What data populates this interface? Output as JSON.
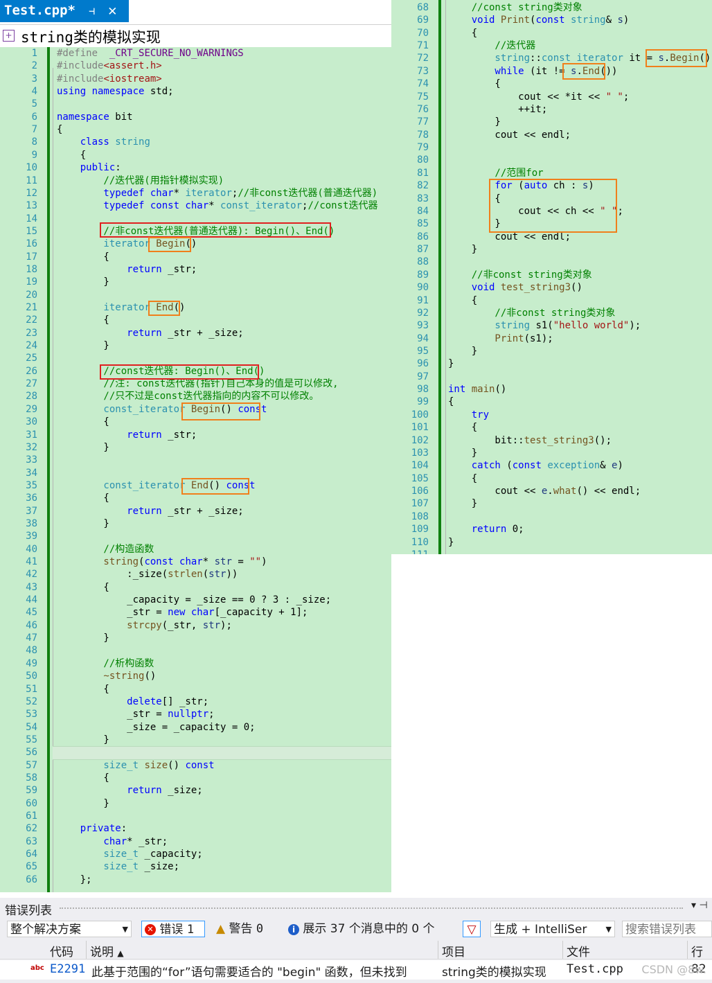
{
  "editor": {
    "tab_title": "Test.cpp*",
    "tab_pin_glyph": "⊣",
    "tab_close_glyph": "✕",
    "nav_project": "string类的模拟实现"
  },
  "left_lines": [
    {
      "n": "1",
      "t": [
        [
          "#define",
          "pp"
        ],
        [
          "  _CRT_SECURE_NO_WARNINGS",
          "mv"
        ]
      ]
    },
    {
      "n": "2",
      "t": [
        [
          "#include",
          "pp"
        ],
        [
          "<assert.h>",
          "st"
        ]
      ]
    },
    {
      "n": "3",
      "t": [
        [
          "#include",
          "pp"
        ],
        [
          "<iostream>",
          "st"
        ]
      ]
    },
    {
      "n": "4",
      "t": [
        [
          "using namespace ",
          "kw"
        ],
        [
          "std;",
          ""
        ]
      ]
    },
    {
      "n": "5",
      "t": []
    },
    {
      "n": "6",
      "t": [
        [
          "namespace ",
          "kw"
        ],
        [
          "bit",
          ""
        ]
      ]
    },
    {
      "n": "7",
      "t": [
        [
          "{",
          ""
        ]
      ]
    },
    {
      "n": "8",
      "t": [
        [
          "    class ",
          "kw"
        ],
        [
          "string",
          "ty"
        ]
      ]
    },
    {
      "n": "9",
      "t": [
        [
          "    {",
          ""
        ]
      ]
    },
    {
      "n": "10",
      "t": [
        [
          "    public",
          "kw"
        ],
        [
          ":",
          ""
        ]
      ]
    },
    {
      "n": "11",
      "t": [
        [
          "        //迭代器(用指针模拟实现)",
          "cm"
        ]
      ]
    },
    {
      "n": "12",
      "t": [
        [
          "        typedef ",
          "kw"
        ],
        [
          "char",
          "kw"
        ],
        [
          "* ",
          ""
        ],
        [
          "iterator",
          "ty"
        ],
        [
          ";",
          ""
        ],
        [
          "//非const迭代器(普通迭代器)",
          "cm"
        ]
      ]
    },
    {
      "n": "13",
      "t": [
        [
          "        typedef const char",
          "kw"
        ],
        [
          "* ",
          ""
        ],
        [
          "const_iterator",
          "ty"
        ],
        [
          ";",
          ""
        ],
        [
          "//const迭代器",
          "cm"
        ]
      ]
    },
    {
      "n": "14",
      "t": []
    },
    {
      "n": "15",
      "t": [
        [
          "        //非const迭代器(普通迭代器): Begin()、End()",
          "cm"
        ]
      ]
    },
    {
      "n": "16",
      "t": [
        [
          "        iterator ",
          "ty"
        ],
        [
          "Begin",
          "fn"
        ],
        [
          "()",
          ""
        ]
      ]
    },
    {
      "n": "17",
      "t": [
        [
          "        {",
          ""
        ]
      ]
    },
    {
      "n": "18",
      "t": [
        [
          "            return ",
          "kw"
        ],
        [
          "_str;",
          ""
        ]
      ]
    },
    {
      "n": "19",
      "t": [
        [
          "        }",
          ""
        ]
      ]
    },
    {
      "n": "20",
      "t": []
    },
    {
      "n": "21",
      "t": [
        [
          "        iterator ",
          "ty"
        ],
        [
          "End",
          "fn"
        ],
        [
          "()",
          ""
        ]
      ]
    },
    {
      "n": "22",
      "t": [
        [
          "        {",
          ""
        ]
      ]
    },
    {
      "n": "23",
      "t": [
        [
          "            return ",
          "kw"
        ],
        [
          "_str + _size;",
          ""
        ]
      ]
    },
    {
      "n": "24",
      "t": [
        [
          "        }",
          ""
        ]
      ]
    },
    {
      "n": "25",
      "t": []
    },
    {
      "n": "26",
      "t": [
        [
          "        //const迭代器: Begin()、End()",
          "cm"
        ]
      ]
    },
    {
      "n": "27",
      "t": [
        [
          "        //注: const迭代器(指针)自己本身的值是可以修改,",
          "cm"
        ]
      ]
    },
    {
      "n": "28",
      "t": [
        [
          "        //只不过是const迭代器指向的内容不可以修改。",
          "cm"
        ]
      ]
    },
    {
      "n": "29",
      "t": [
        [
          "        const_iterator ",
          "ty"
        ],
        [
          "Begin",
          "fn"
        ],
        [
          "() ",
          ""
        ],
        [
          "const",
          "kw"
        ]
      ]
    },
    {
      "n": "30",
      "t": [
        [
          "        {",
          ""
        ]
      ]
    },
    {
      "n": "31",
      "t": [
        [
          "            return ",
          "kw"
        ],
        [
          "_str;",
          ""
        ]
      ]
    },
    {
      "n": "32",
      "t": [
        [
          "        }",
          ""
        ]
      ]
    },
    {
      "n": "33",
      "t": []
    },
    {
      "n": "34",
      "t": []
    },
    {
      "n": "35",
      "t": [
        [
          "        const_iterator ",
          "ty"
        ],
        [
          "End",
          "fn"
        ],
        [
          "() ",
          ""
        ],
        [
          "const",
          "kw"
        ]
      ]
    },
    {
      "n": "36",
      "t": [
        [
          "        {",
          ""
        ]
      ]
    },
    {
      "n": "37",
      "t": [
        [
          "            return ",
          "kw"
        ],
        [
          "_str + _size;",
          ""
        ]
      ]
    },
    {
      "n": "38",
      "t": [
        [
          "        }",
          ""
        ]
      ]
    },
    {
      "n": "39",
      "t": []
    },
    {
      "n": "40",
      "t": [
        [
          "        //构造函数",
          "cm"
        ]
      ]
    },
    {
      "n": "41",
      "t": [
        [
          "        string",
          "fn"
        ],
        [
          "(",
          ""
        ],
        [
          "const char",
          "kw"
        ],
        [
          "* ",
          ""
        ],
        [
          "str",
          "pr"
        ],
        [
          " = ",
          ""
        ],
        [
          "\"\"",
          "st"
        ],
        [
          ")",
          ""
        ]
      ]
    },
    {
      "n": "42",
      "t": [
        [
          "            :_size(",
          ""
        ],
        [
          "strlen",
          "fn"
        ],
        [
          "(",
          ""
        ],
        [
          "str",
          "pr"
        ],
        [
          "))",
          ""
        ]
      ]
    },
    {
      "n": "43",
      "t": [
        [
          "        {",
          ""
        ]
      ]
    },
    {
      "n": "44",
      "t": [
        [
          "            _capacity = _size == 0 ? 3 : _size;",
          ""
        ]
      ]
    },
    {
      "n": "45",
      "t": [
        [
          "            _str = ",
          ""
        ],
        [
          "new char",
          "kw"
        ],
        [
          "[_capacity + 1];",
          ""
        ]
      ]
    },
    {
      "n": "46",
      "t": [
        [
          "            strcpy",
          "fn"
        ],
        [
          "(_str, ",
          ""
        ],
        [
          "str",
          "pr"
        ],
        [
          ");",
          ""
        ]
      ]
    },
    {
      "n": "47",
      "t": [
        [
          "        }",
          ""
        ]
      ]
    },
    {
      "n": "48",
      "t": []
    },
    {
      "n": "49",
      "t": [
        [
          "        //析构函数",
          "cm"
        ]
      ]
    },
    {
      "n": "50",
      "t": [
        [
          "        ~string",
          "fn"
        ],
        [
          "()",
          ""
        ]
      ]
    },
    {
      "n": "51",
      "t": [
        [
          "        {",
          ""
        ]
      ]
    },
    {
      "n": "52",
      "t": [
        [
          "            delete",
          "kw"
        ],
        [
          "[] _str;",
          ""
        ]
      ]
    },
    {
      "n": "53",
      "t": [
        [
          "            _str = ",
          ""
        ],
        [
          "nullptr",
          "kw"
        ],
        [
          ";",
          ""
        ]
      ]
    },
    {
      "n": "54",
      "t": [
        [
          "            _size = _capacity = 0;",
          ""
        ]
      ]
    },
    {
      "n": "55",
      "t": [
        [
          "        }",
          ""
        ]
      ]
    },
    {
      "n": "56",
      "t": []
    },
    {
      "n": "57",
      "t": [
        [
          "        size_t ",
          "ty"
        ],
        [
          "size",
          "fn"
        ],
        [
          "() ",
          ""
        ],
        [
          "const",
          "kw"
        ]
      ]
    },
    {
      "n": "58",
      "t": [
        [
          "        {",
          ""
        ]
      ]
    },
    {
      "n": "59",
      "t": [
        [
          "            return ",
          "kw"
        ],
        [
          "_size;",
          ""
        ]
      ]
    },
    {
      "n": "60",
      "t": [
        [
          "        }",
          ""
        ]
      ]
    },
    {
      "n": "61",
      "t": []
    },
    {
      "n": "62",
      "t": [
        [
          "    private",
          "kw"
        ],
        [
          ":",
          ""
        ]
      ]
    },
    {
      "n": "63",
      "t": [
        [
          "        char",
          "kw"
        ],
        [
          "* _str;",
          ""
        ]
      ]
    },
    {
      "n": "64",
      "t": [
        [
          "        size_t ",
          "ty"
        ],
        [
          "_capacity;",
          ""
        ]
      ]
    },
    {
      "n": "65",
      "t": [
        [
          "        size_t ",
          "ty"
        ],
        [
          "_size;",
          ""
        ]
      ]
    },
    {
      "n": "66",
      "t": [
        [
          "    };",
          ""
        ]
      ]
    }
  ],
  "right_lines": [
    {
      "n": "68",
      "t": [
        [
          "    //const string类对象",
          "cm"
        ]
      ]
    },
    {
      "n": "69",
      "t": [
        [
          "    void ",
          "kw"
        ],
        [
          "Print",
          "fn"
        ],
        [
          "(",
          ""
        ],
        [
          "const ",
          "kw"
        ],
        [
          "string",
          "ty"
        ],
        [
          "& ",
          ""
        ],
        [
          "s",
          "pr"
        ],
        [
          ")",
          ""
        ]
      ]
    },
    {
      "n": "70",
      "t": [
        [
          "    {",
          ""
        ]
      ]
    },
    {
      "n": "71",
      "t": [
        [
          "        //迭代器",
          "cm"
        ]
      ]
    },
    {
      "n": "72",
      "t": [
        [
          "        string",
          "ty"
        ],
        [
          "::",
          ""
        ],
        [
          "const_iterator ",
          "ty"
        ],
        [
          "it = ",
          ""
        ],
        [
          "s",
          "pr"
        ],
        [
          ".",
          ""
        ],
        [
          "Begin",
          "fn"
        ],
        [
          "();",
          ""
        ]
      ]
    },
    {
      "n": "73",
      "t": [
        [
          "        while ",
          "kw"
        ],
        [
          "(it != ",
          ""
        ],
        [
          "s",
          "pr"
        ],
        [
          ".",
          ""
        ],
        [
          "End",
          "fn"
        ],
        [
          "())",
          ""
        ]
      ]
    },
    {
      "n": "74",
      "t": [
        [
          "        {",
          ""
        ]
      ]
    },
    {
      "n": "75",
      "t": [
        [
          "            cout << *it << ",
          ""
        ],
        [
          "\" \"",
          "st"
        ],
        [
          ";",
          ""
        ]
      ]
    },
    {
      "n": "76",
      "t": [
        [
          "            ++it;",
          ""
        ]
      ]
    },
    {
      "n": "77",
      "t": [
        [
          "        }",
          ""
        ]
      ]
    },
    {
      "n": "78",
      "t": [
        [
          "        cout << endl;",
          ""
        ]
      ]
    },
    {
      "n": "79",
      "t": []
    },
    {
      "n": "80",
      "t": []
    },
    {
      "n": "81",
      "t": [
        [
          "        //范围for",
          "cm"
        ]
      ]
    },
    {
      "n": "82",
      "t": [
        [
          "        for ",
          "kw"
        ],
        [
          "(",
          ""
        ],
        [
          "auto ",
          "kw"
        ],
        [
          "ch : ",
          ""
        ],
        [
          "s",
          "pr"
        ],
        [
          ")",
          ""
        ]
      ]
    },
    {
      "n": "83",
      "t": [
        [
          "        {",
          ""
        ]
      ]
    },
    {
      "n": "84",
      "t": [
        [
          "            cout << ch << ",
          ""
        ],
        [
          "\" \"",
          "st"
        ],
        [
          ";",
          ""
        ]
      ]
    },
    {
      "n": "85",
      "t": [
        [
          "        }",
          ""
        ]
      ]
    },
    {
      "n": "86",
      "t": [
        [
          "        cout << endl;",
          ""
        ]
      ]
    },
    {
      "n": "87",
      "t": [
        [
          "    }",
          ""
        ]
      ]
    },
    {
      "n": "88",
      "t": []
    },
    {
      "n": "89",
      "t": [
        [
          "    //非const string类对象",
          "cm"
        ]
      ]
    },
    {
      "n": "90",
      "t": [
        [
          "    void ",
          "kw"
        ],
        [
          "test_string3",
          "fn"
        ],
        [
          "()",
          ""
        ]
      ]
    },
    {
      "n": "91",
      "t": [
        [
          "    {",
          ""
        ]
      ]
    },
    {
      "n": "92",
      "t": [
        [
          "        //非const string类对象",
          "cm"
        ]
      ]
    },
    {
      "n": "93",
      "t": [
        [
          "        string ",
          "ty"
        ],
        [
          "s1(",
          ""
        ],
        [
          "\"hello world\"",
          "st"
        ],
        [
          ");",
          ""
        ]
      ]
    },
    {
      "n": "94",
      "t": [
        [
          "        Print",
          "fn"
        ],
        [
          "(s1);",
          ""
        ]
      ]
    },
    {
      "n": "95",
      "t": [
        [
          "    }",
          ""
        ]
      ]
    },
    {
      "n": "96",
      "t": [
        [
          "}",
          ""
        ]
      ]
    },
    {
      "n": "97",
      "t": []
    },
    {
      "n": "98",
      "t": [
        [
          "int ",
          "kw"
        ],
        [
          "main",
          "fn"
        ],
        [
          "()",
          ""
        ]
      ]
    },
    {
      "n": "99",
      "t": [
        [
          "{",
          ""
        ]
      ]
    },
    {
      "n": "100",
      "t": [
        [
          "    try",
          "kw"
        ]
      ]
    },
    {
      "n": "101",
      "t": [
        [
          "    {",
          ""
        ]
      ]
    },
    {
      "n": "102",
      "t": [
        [
          "        bit::",
          ""
        ],
        [
          "test_string3",
          "fn"
        ],
        [
          "();",
          ""
        ]
      ]
    },
    {
      "n": "103",
      "t": [
        [
          "    }",
          ""
        ]
      ]
    },
    {
      "n": "104",
      "t": [
        [
          "    catch ",
          "kw"
        ],
        [
          "(",
          ""
        ],
        [
          "const ",
          "kw"
        ],
        [
          "exception",
          "ty"
        ],
        [
          "& ",
          ""
        ],
        [
          "e",
          "pr"
        ],
        [
          ")",
          ""
        ]
      ]
    },
    {
      "n": "105",
      "t": [
        [
          "    {",
          ""
        ]
      ]
    },
    {
      "n": "106",
      "t": [
        [
          "        cout << ",
          ""
        ],
        [
          "e",
          "pr"
        ],
        [
          ".",
          ""
        ],
        [
          "what",
          "fn"
        ],
        [
          "() << endl;",
          ""
        ]
      ]
    },
    {
      "n": "107",
      "t": [
        [
          "    }",
          ""
        ]
      ]
    },
    {
      "n": "108",
      "t": []
    },
    {
      "n": "109",
      "t": [
        [
          "    return ",
          "kw"
        ],
        [
          "0;",
          ""
        ]
      ]
    },
    {
      "n": "110",
      "t": [
        [
          "}",
          ""
        ]
      ]
    },
    {
      "n": "111",
      "t": []
    }
  ],
  "error_list": {
    "title": "错误列表",
    "pin_glyph": "▾ ⊣",
    "scope": "整个解决方案",
    "errors_label": "错误",
    "errors_count": "1",
    "warnings_label": "警告",
    "warnings_count": "0",
    "messages_label": "展示 37 个消息中的 0 个",
    "build_filter": "生成 + IntelliSer",
    "search_placeholder": "搜索错误列表",
    "columns": {
      "code": "代码",
      "description": "说明",
      "project": "项目",
      "file": "文件",
      "line": "行"
    },
    "row": {
      "code": "E2291",
      "description": "此基于范围的“for”语句需要适合的 \"begin\" 函数，但未找到",
      "project": "string类的模拟实现",
      "file": "Test.cpp",
      "line": "82"
    },
    "watermark": "CSDN @8w."
  }
}
